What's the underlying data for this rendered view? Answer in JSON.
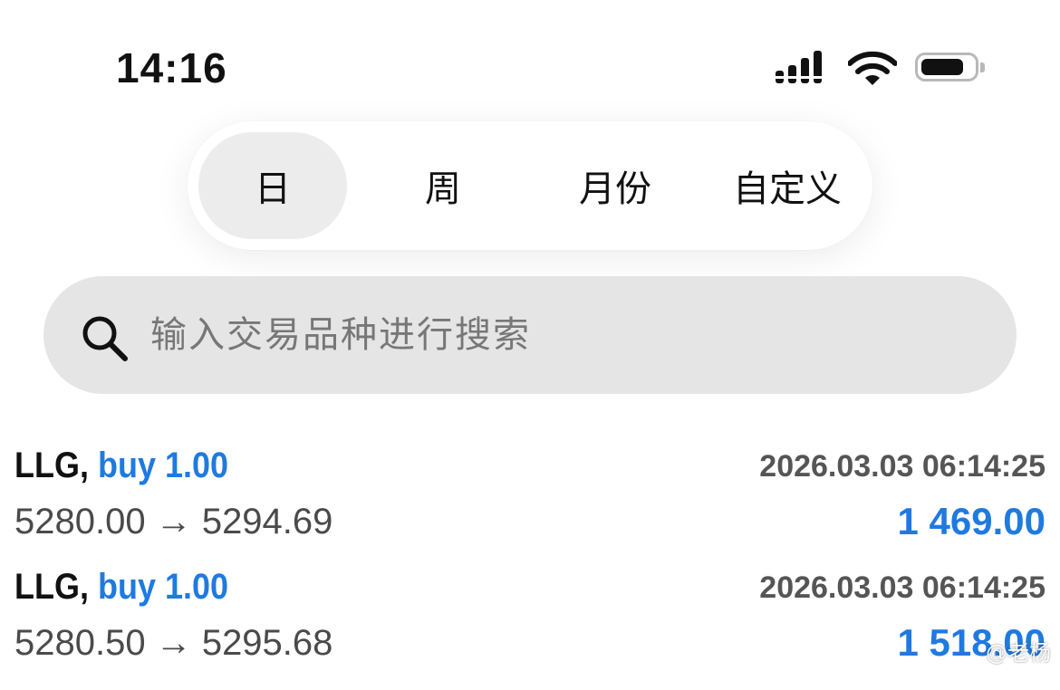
{
  "status_bar": {
    "time": "14:16",
    "signal_icon": "signal-bars-icon",
    "wifi_icon": "wifi-icon",
    "battery_icon": "battery-icon"
  },
  "period_tabs": {
    "items": [
      "日",
      "周",
      "月份",
      "自定义"
    ],
    "selected": "日"
  },
  "search": {
    "placeholder": "输入交易品种进行搜索",
    "icon": "search-icon"
  },
  "deals": [
    {
      "symbol": "LLG,",
      "side": "buy 1.00",
      "datetime": "2026.03.03 06:14:25",
      "prices": "5280.00 → 5294.69",
      "profit": "1 469.00"
    },
    {
      "symbol": "LLG,",
      "side": "buy 1.00",
      "datetime": "2026.03.03 06:14:25",
      "prices": "5280.50 → 5295.68",
      "profit": "1 518.00"
    }
  ],
  "watermark": "@老杨",
  "colors": {
    "accent": "#1f7ae0",
    "tab_active_bg": "#ececec",
    "search_bg": "#e5e5e5"
  }
}
